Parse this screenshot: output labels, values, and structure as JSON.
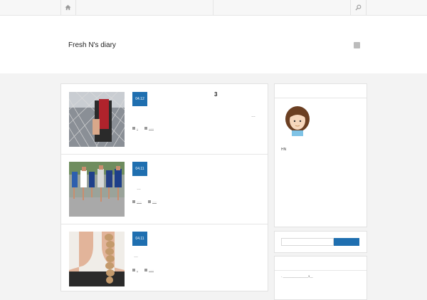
{
  "nav": {
    "home_icon": "home-icon",
    "search_icon": "search-icon"
  },
  "header": {
    "site_title": "Fresh N's diary",
    "feed_icon": "rss-icon"
  },
  "posts": [
    {
      "date": "04.12",
      "title": "3",
      "excerpt": "…",
      "meta": [
        "..",
        "......"
      ]
    },
    {
      "date": "04.11",
      "title": "",
      "excerpt": "…",
      "meta": [
        "......",
        "......"
      ]
    },
    {
      "date": "04.11",
      "title": "",
      "excerpt": "…",
      "meta": [
        "..",
        "......"
      ]
    }
  ],
  "sidebar": {
    "profile": {
      "name": "HN"
    },
    "archive": {
      "line": "- ________________3__"
    }
  },
  "colors": {
    "accent": "#1f6fb0",
    "background": "#f3f3f3"
  }
}
